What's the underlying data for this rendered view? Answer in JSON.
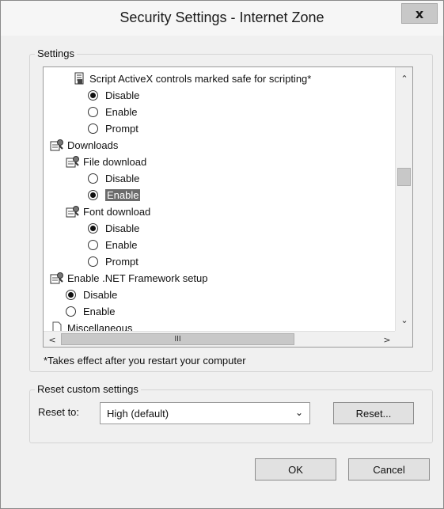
{
  "window": {
    "title": "Security Settings - Internet Zone",
    "close_glyph": "x"
  },
  "settings_group": {
    "label": "Settings",
    "items": [
      {
        "type": "setting",
        "icon": "script-icon",
        "label": "Script ActiveX controls marked safe for scripting*"
      },
      {
        "type": "radio",
        "label": "Disable",
        "checked": true
      },
      {
        "type": "radio",
        "label": "Enable",
        "checked": false
      },
      {
        "type": "radio",
        "label": "Prompt",
        "checked": false
      },
      {
        "type": "category",
        "icon": "settings-icon",
        "label": "Downloads"
      },
      {
        "type": "setting",
        "icon": "settings-icon",
        "label": "File download"
      },
      {
        "type": "radio",
        "label": "Disable",
        "checked": false
      },
      {
        "type": "radio",
        "label": "Enable",
        "checked": true,
        "selected": true
      },
      {
        "type": "setting",
        "icon": "settings-icon",
        "label": "Font download"
      },
      {
        "type": "radio",
        "label": "Disable",
        "checked": true
      },
      {
        "type": "radio",
        "label": "Enable",
        "checked": false
      },
      {
        "type": "radio",
        "label": "Prompt",
        "checked": false
      },
      {
        "type": "category",
        "icon": "settings-icon",
        "label": "Enable .NET Framework setup"
      },
      {
        "type": "radio",
        "label": "Disable",
        "checked": true
      },
      {
        "type": "radio",
        "label": "Enable",
        "checked": false
      },
      {
        "type": "category",
        "icon": "document-icon",
        "label": "Miscellaneous"
      }
    ],
    "restart_note": "*Takes effect after you restart your computer"
  },
  "scrollbar": {
    "up_glyph": "⌃",
    "down_glyph": "⌄",
    "left_glyph": "<",
    "right_glyph": ">",
    "grip_glyph": "III"
  },
  "reset_group": {
    "label": "Reset custom settings",
    "reset_to_label": "Reset to:",
    "selected_level": "High (default)",
    "reset_button": "Reset..."
  },
  "footer": {
    "ok_button": "OK",
    "cancel_button": "Cancel"
  }
}
